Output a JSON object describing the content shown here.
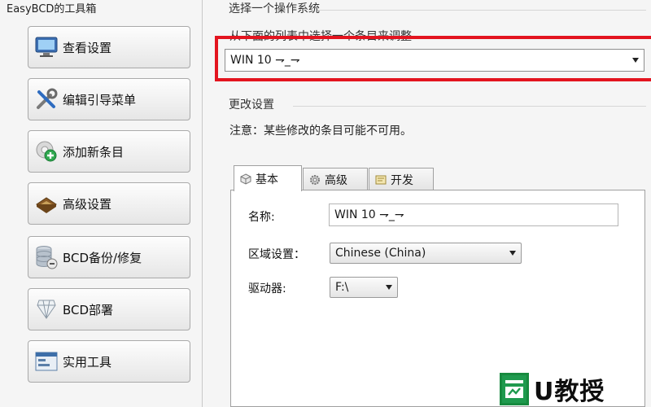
{
  "toolbox": {
    "title": "EasyBCD的工具箱",
    "buttons": [
      {
        "label": "查看设置",
        "icon": "monitor-icon"
      },
      {
        "label": "编辑引导菜单",
        "icon": "tools-icon"
      },
      {
        "label": "添加新条目",
        "icon": "add-entry-icon"
      },
      {
        "label": "高级设置",
        "icon": "advanced-chip-icon"
      },
      {
        "label": "BCD备份/修复",
        "icon": "database-icon"
      },
      {
        "label": "BCD部署",
        "icon": "deploy-icon"
      },
      {
        "label": "实用工具",
        "icon": "utilities-icon"
      }
    ]
  },
  "os_section": {
    "title": "选择一个操作系统",
    "instruction": "从下面的列表中选择一个条目来调整",
    "selected_os": "WIN 10 ⇁_⇁"
  },
  "settings_section": {
    "title": "更改设置",
    "note": "注意：某些修改的条目可能不可用。"
  },
  "tabs": [
    {
      "label": "基本",
      "icon": "cube-icon",
      "active": true
    },
    {
      "label": "高级",
      "icon": "gear-icon",
      "active": false
    },
    {
      "label": "开发",
      "icon": "dev-icon",
      "active": false
    }
  ],
  "form": {
    "name_label": "名称:",
    "name_value": "WIN 10 ⇁_⇁",
    "locale_label": "区域设置：",
    "locale_value": "Chinese (China)",
    "drive_label": "驱动器:",
    "drive_value": "F:\\"
  },
  "watermark": {
    "text": "U教授"
  },
  "colors": {
    "highlight_frame": "#e3141f",
    "watermark_green": "#1f9a4e"
  }
}
